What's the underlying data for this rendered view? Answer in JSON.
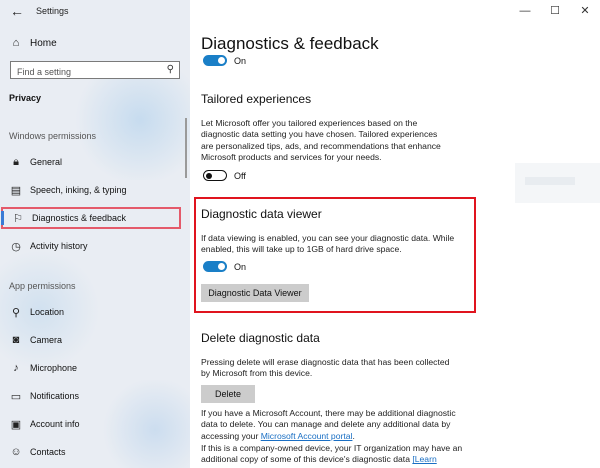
{
  "window": {
    "title": "Settings",
    "minimize": "—",
    "maximize": "☐",
    "close": "✕"
  },
  "sidebar": {
    "home": "Home",
    "search_placeholder": "Find a setting",
    "section": "Privacy",
    "groups": [
      "Windows permissions",
      "App permissions"
    ],
    "windows_items": [
      {
        "label": "General",
        "icon": "lock-icon"
      },
      {
        "label": "Speech, inking, & typing",
        "icon": "notebook-icon"
      },
      {
        "label": "Diagnostics & feedback",
        "icon": "feedback-icon",
        "selected": true
      },
      {
        "label": "Activity history",
        "icon": "history-icon"
      }
    ],
    "app_items": [
      {
        "label": "Location",
        "icon": "location-icon"
      },
      {
        "label": "Camera",
        "icon": "camera-icon"
      },
      {
        "label": "Microphone",
        "icon": "microphone-icon"
      },
      {
        "label": "Notifications",
        "icon": "notifications-icon"
      },
      {
        "label": "Account info",
        "icon": "account-icon"
      },
      {
        "label": "Contacts",
        "icon": "contacts-icon"
      }
    ]
  },
  "main": {
    "title": "Diagnostics & feedback",
    "top_toggle": "On",
    "tailored": {
      "heading": "Tailored experiences",
      "text": "Let Microsoft offer you tailored experiences based on the diagnostic data setting you have chosen. Tailored experiences are personalized tips, ads, and recommendations that enhance Microsoft products and services for your needs.",
      "toggle": "Off"
    },
    "viewer": {
      "heading": "Diagnostic data viewer",
      "text": "If data viewing is enabled, you can see your diagnostic data. While enabled, this will take up to 1GB of hard drive space.",
      "toggle": "On",
      "button": "Diagnostic Data Viewer"
    },
    "delete": {
      "heading": "Delete diagnostic data",
      "text": "Pressing delete will erase diagnostic data that has been collected by Microsoft from this device.",
      "button": "Delete",
      "info1_pre": "If you have a Microsoft Account, there may be additional diagnostic data to delete. You can manage and delete any additional data by accessing your ",
      "info1_link": "Microsoft Account portal",
      "info1_post": ".",
      "info2_pre": "If this is a company-owned device, your IT organization may have an additional copy of some of this device's diagnostic data ",
      "info2_link": "[Learn"
    }
  }
}
